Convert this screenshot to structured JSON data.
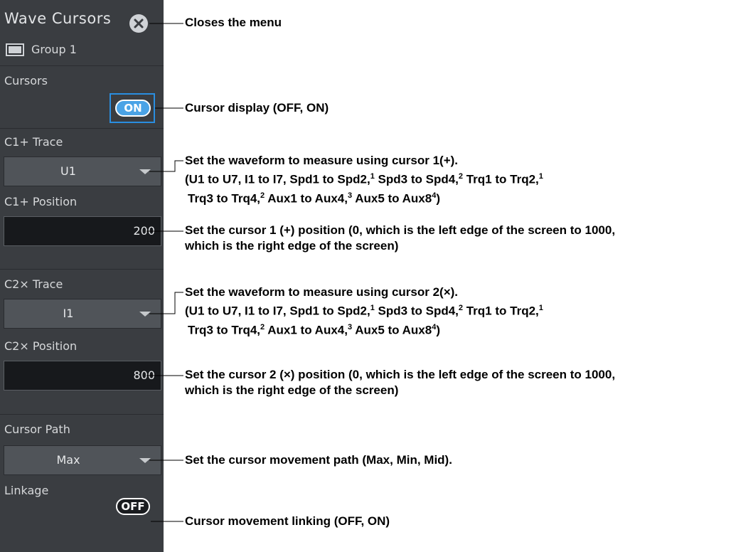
{
  "menu": {
    "title": "Wave Cursors",
    "group_label": "Group 1",
    "cursors": {
      "label": "Cursors",
      "state": "ON"
    },
    "c1_trace": {
      "label": "C1+ Trace",
      "value": "U1"
    },
    "c1_position": {
      "label": "C1+ Position",
      "value": "200"
    },
    "c2_trace": {
      "label": "C2× Trace",
      "value": "I1"
    },
    "c2_position": {
      "label": "C2× Position",
      "value": "800"
    },
    "cursor_path": {
      "label": "Cursor Path",
      "value": "Max"
    },
    "linkage": {
      "label": "Linkage",
      "state": "OFF"
    }
  },
  "callouts": {
    "close": "Closes the menu",
    "cursor_display": "Cursor display (OFF, ON)",
    "c1_trace": {
      "line1": "Set the waveform to measure using cursor 1(+).",
      "line2_a": "(U1 to U7, I1 to I7, Spd1 to Spd2,",
      "line2_b": " Spd3 to Spd4,",
      "line2_c": " Trq1 to Trq2,",
      "line3_a": "Trq3 to Trq4,",
      "line3_b": " Aux1 to Aux4,",
      "line3_c": " Aux5 to Aux8",
      "line3_d": ")"
    },
    "c1_position": {
      "line1": "Set the cursor 1 (+) position (0, which is the left edge of the screen to 1000,",
      "line2": "which is the right edge of the screen)"
    },
    "c2_trace": {
      "line1": "Set the waveform to measure using cursor 2(×).",
      "line2_a": "(U1 to U7, I1 to I7, Spd1 to Spd2,",
      "line2_b": " Spd3 to Spd4,",
      "line2_c": " Trq1 to Trq2,",
      "line3_a": "Trq3 to Trq4,",
      "line3_b": " Aux1 to Aux4,",
      "line3_c": " Aux5 to Aux8",
      "line3_d": ")"
    },
    "c2_position": {
      "line1": "Set the cursor 2 (×) position (0, which is the left edge of the screen to 1000,",
      "line2": "which is the right edge of the screen)"
    },
    "cursor_path": "Set the cursor movement path (Max, Min, Mid).",
    "linkage": "Cursor movement linking (OFF, ON)"
  },
  "footnote_marks": {
    "one": "1",
    "two": "2",
    "three": "3",
    "four": "4"
  },
  "colors": {
    "panel_bg": "#3a3d41",
    "accent_blue": "#4aa3e6",
    "selection_frame": "#2a8ee0"
  },
  "icons": {
    "close": "close-icon",
    "group": "group-display-icon",
    "dropdown": "chevron-down-icon"
  }
}
